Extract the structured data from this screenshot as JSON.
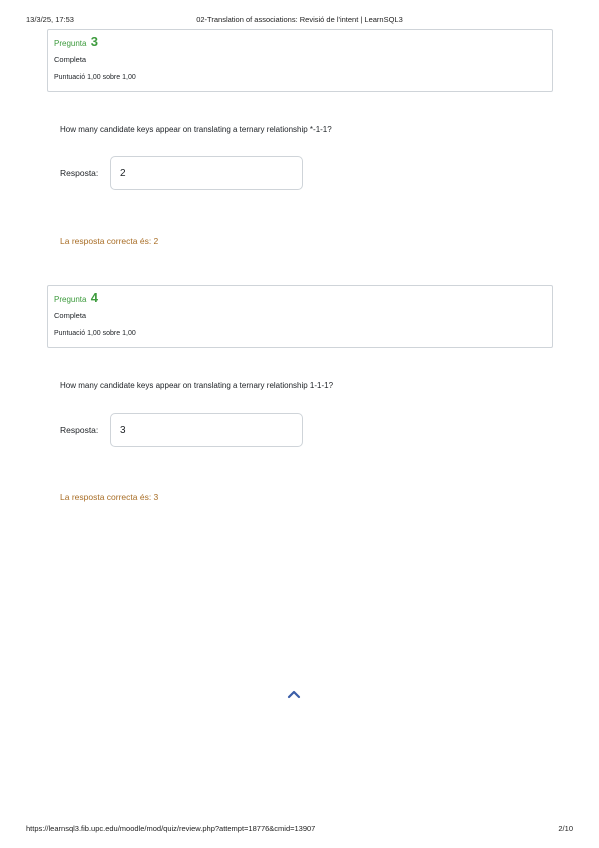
{
  "header": {
    "datetime": "13/3/25, 17:53",
    "title": "02-Translation of associations: Revisió de l'intent | LearnSQL3"
  },
  "questions": [
    {
      "label": "Pregunta",
      "number": "3",
      "state": "Completa",
      "grade": "Puntuació 1,00 sobre 1,00",
      "text": "How many candidate keys appear on translating a ternary relationship *-1-1?",
      "response_label": "Resposta:",
      "answer": "2",
      "right_answer": "La resposta correcta és: 2"
    },
    {
      "label": "Pregunta",
      "number": "4",
      "state": "Completa",
      "grade": "Puntuació 1,00 sobre 1,00",
      "text": "How many candidate keys appear on translating a ternary relationship 1-1-1?",
      "response_label": "Resposta:",
      "answer": "3",
      "right_answer": "La resposta correcta és: 3"
    }
  ],
  "back_to_top_icon": "chevron-up-icon",
  "colors": {
    "question_title": "#3d9b3d",
    "right_answer": "#a86d25",
    "chevron": "#3b5ea8",
    "border": "#cfd4d9"
  },
  "footer": {
    "url": "https://learnsql3.fib.upc.edu/moodle/mod/quiz/review.php?attempt=18776&cmid=13907",
    "page": "2/10"
  }
}
